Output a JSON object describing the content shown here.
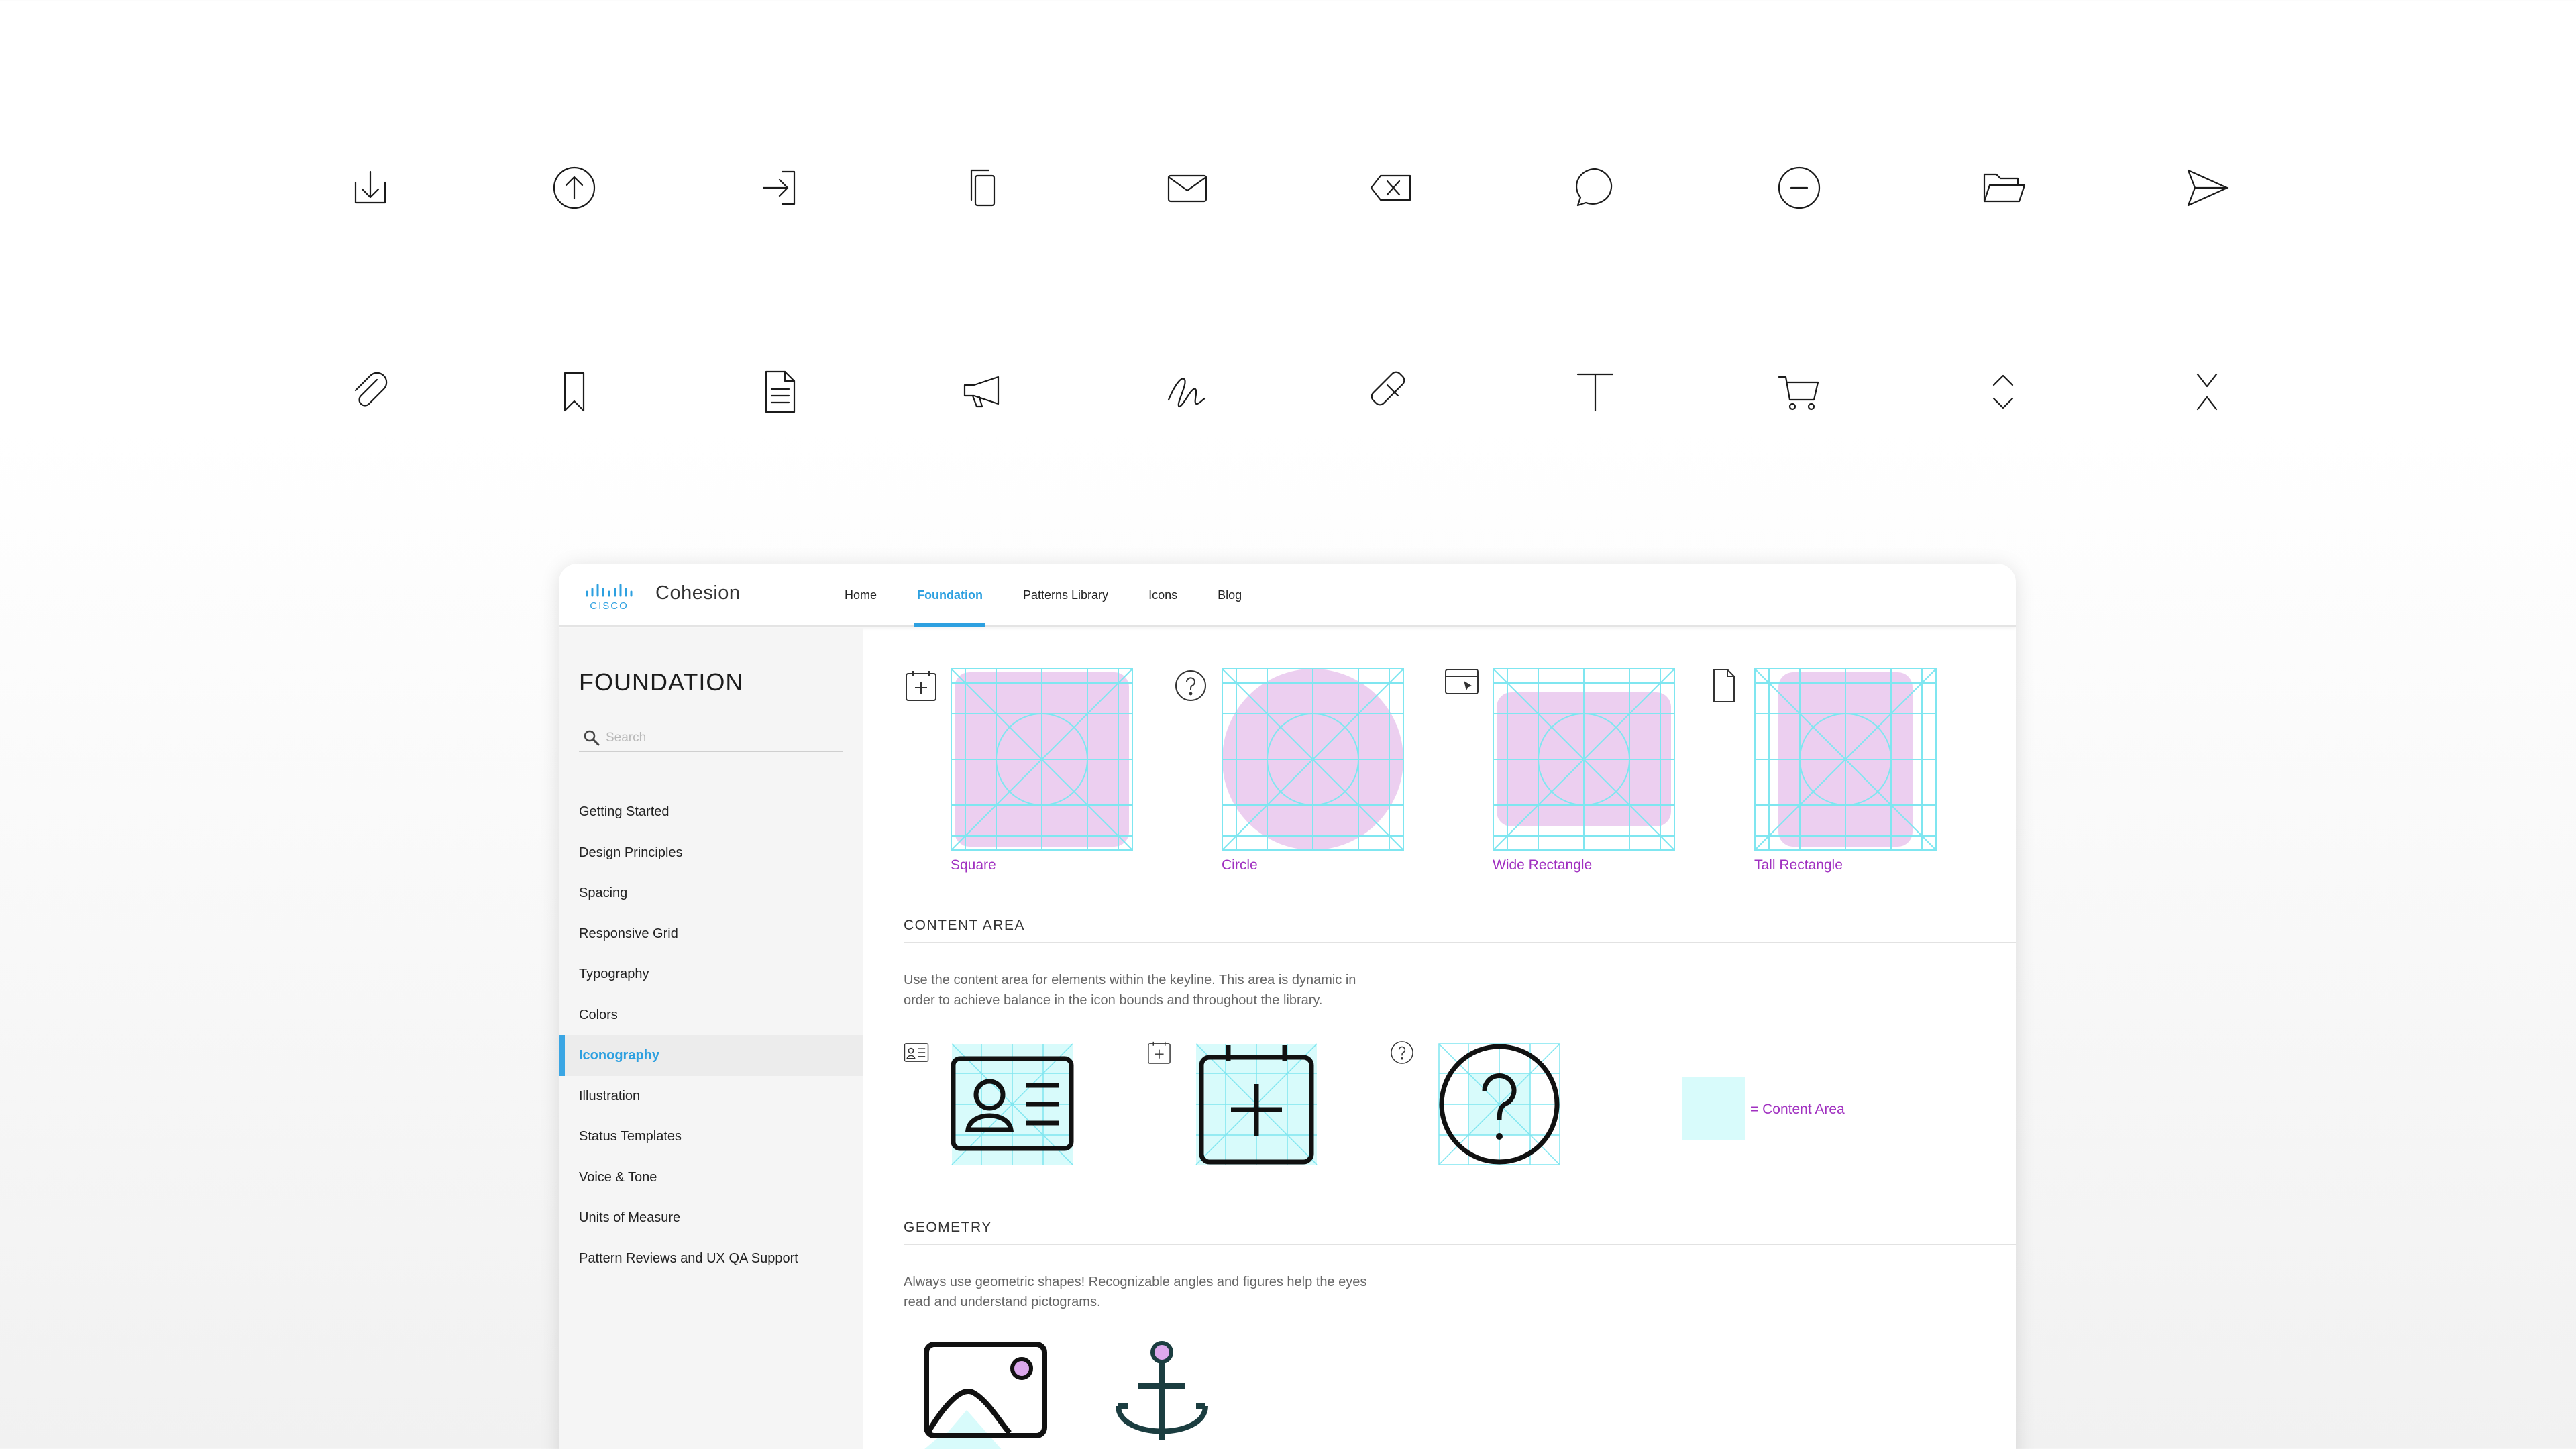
{
  "icon_rows": {
    "row1": [
      "download-icon",
      "upload-circle-icon",
      "sign-in-icon",
      "copy-icon",
      "mail-icon",
      "backspace-icon",
      "chat-bubble-icon",
      "minus-circle-icon",
      "folder-open-icon",
      "send-icon"
    ],
    "row2": [
      "attachment-icon",
      "bookmark-icon",
      "document-icon",
      "megaphone-icon",
      "signature-icon",
      "eraser-icon",
      "text-icon",
      "cart-icon",
      "expand-vertical-icon",
      "collapse-vertical-icon"
    ]
  },
  "app": {
    "brand_logo_text": "CISCO",
    "brand": "Cohesion"
  },
  "nav": {
    "items": [
      "Home",
      "Foundation",
      "Patterns Library",
      "Icons",
      "Blog"
    ],
    "active": "Foundation"
  },
  "sidebar": {
    "title": "FOUNDATION",
    "search_placeholder": "Search",
    "items": [
      "Getting Started",
      "Design Principles",
      "Spacing",
      "Responsive Grid",
      "Typography",
      "Colors",
      "Iconography",
      "Illustration",
      "Status Templates",
      "Voice & Tone",
      "Units of Measure",
      "Pattern Reviews and UX QA Support"
    ],
    "active": "Iconography"
  },
  "keylines": {
    "shapes": [
      "Square",
      "Circle",
      "Wide Rectangle",
      "Tall Rectangle"
    ]
  },
  "content_area": {
    "title": "CONTENT AREA",
    "description": "Use the content area for elements within the keyline. This area is dynamic in order to achieve balance in the icon bounds and throughout the library.",
    "legend": "= Content Area"
  },
  "geometry": {
    "title": "GEOMETRY",
    "description": "Always use geometric shapes! Recognizable angles and figures help the eyes read and understand pictograms."
  },
  "colors": {
    "accent_blue": "#2da0e0",
    "keyline_pink": "#eccff0",
    "grid_cyan": "#7fe6f0",
    "label_purple": "#a030c0",
    "content_cyan": "#d8fbfb"
  }
}
